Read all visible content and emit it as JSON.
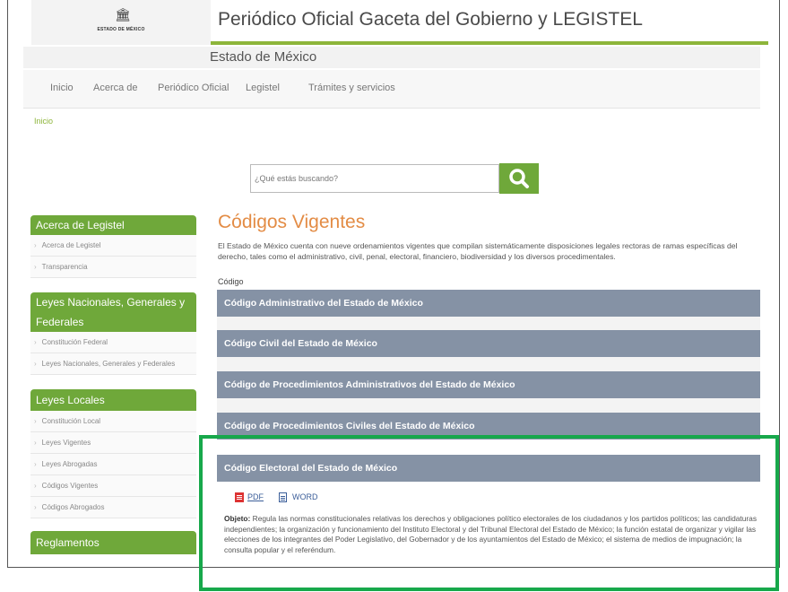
{
  "header": {
    "logo_text": "ESTADO DE MÉXICO",
    "title": "Periódico Oficial Gaceta del Gobierno y LEGISTEL",
    "subtitle": "Estado de México"
  },
  "nav": {
    "items": [
      "Inicio",
      "Acerca de",
      "Periódico Oficial",
      "Legistel",
      "Trámites y servicios"
    ]
  },
  "breadcrumb": "Inicio",
  "search": {
    "placeholder": "¿Qué estás buscando?"
  },
  "sidebar": {
    "sections": [
      {
        "title": "Acerca de Legistel",
        "items": [
          "Acerca de Legistel",
          "Transparencia"
        ]
      },
      {
        "title": "Leyes Nacionales, Generales y Federales",
        "items": [
          "Constitución Federal",
          "Leyes Nacionales, Generales y Federales"
        ]
      },
      {
        "title": "Leyes Locales",
        "items": [
          "Constitución Local",
          "Leyes Vigentes",
          "Leyes Abrogadas",
          "Códigos Vigentes",
          "Códigos Abrogados"
        ]
      },
      {
        "title": "Reglamentos",
        "items": []
      }
    ]
  },
  "main": {
    "title": "Códigos Vigentes",
    "intro": "El Estado de México cuenta con nueve ordenamientos vigentes que compilan sistemáticamente disposiciones legales rectoras de ramas específicas del derecho, tales como el administrativo, civil, penal, electoral, financiero, biodiversidad y los diversos procedimentales.",
    "codigo_label": "Código",
    "codes": [
      "Código Administrativo del Estado de México",
      "Código Civil del Estado de México",
      "Código de Procedimientos Administrativos del Estado de México",
      "Código de Procedimientos Civiles del Estado de México",
      "Código Electoral del Estado de México"
    ],
    "expanded": {
      "pdf_label": "PDF",
      "word_label": "WORD",
      "objeto_label": "Objeto:",
      "objeto_text": "Regula las normas constitucionales relativas los derechos y obligaciones político electorales de los ciudadanos y los partidos políticos; las candidaturas independientes; la organización y funcionamiento del Instituto Electoral y del Tribunal Electoral del Estado de México; la función estatal de organizar y vigilar las elecciones de los integrantes del Poder Legislativo, del Gobernador y de los ayuntamientos del Estado de México; el sistema de medios de impugnación; la consulta popular y el referéndum."
    }
  },
  "colors": {
    "accent_green": "#6fa83a",
    "title_orange": "#e38c45",
    "code_bar": "#8592a5",
    "highlight": "#17a84b"
  }
}
